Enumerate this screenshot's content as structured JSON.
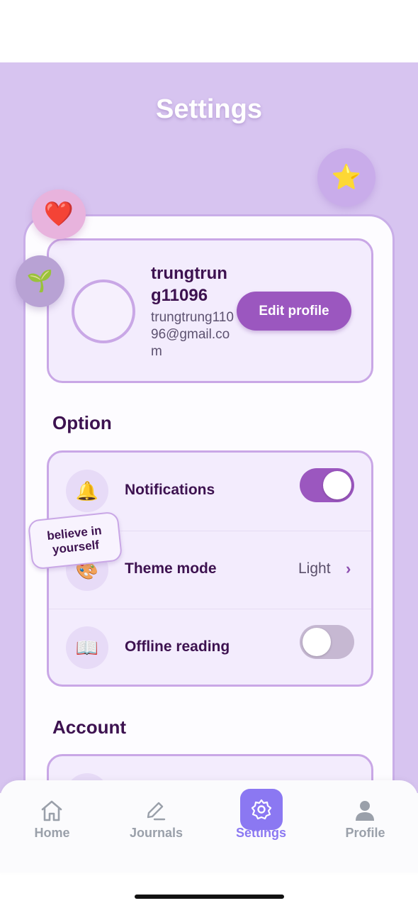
{
  "header": {
    "title": "Settings"
  },
  "decor": {
    "star_emoji": "⭐",
    "heart_emoji": "❤️",
    "sprout_emoji": "🌱"
  },
  "profile": {
    "username": "trungtrung11096",
    "email": "trungtrung11096@gmail.com",
    "edit_label": "Edit profile"
  },
  "sections": {
    "option_title": "Option",
    "account_title": "Account"
  },
  "options": [
    {
      "icon": "bell-icon",
      "emoji": "🔔",
      "label": "Notifications",
      "toggle": true
    },
    {
      "icon": "palette-icon",
      "emoji": "🎨",
      "label": "Theme mode",
      "value": "Light"
    },
    {
      "icon": "book-icon",
      "emoji": "📖",
      "label": "Offline reading",
      "toggle": false
    }
  ],
  "sticker": {
    "text": "believe in yourself"
  },
  "nav": {
    "items": [
      {
        "label": "Home",
        "icon": "home-icon"
      },
      {
        "label": "Journals",
        "icon": "pen-icon"
      },
      {
        "label": "Settings",
        "icon": "gear-icon",
        "active": true
      },
      {
        "label": "Profile",
        "icon": "person-icon"
      }
    ]
  },
  "colors": {
    "accent": "#9b57bf",
    "nav_active": "#8b78f2",
    "background": "#d7c4f0"
  }
}
